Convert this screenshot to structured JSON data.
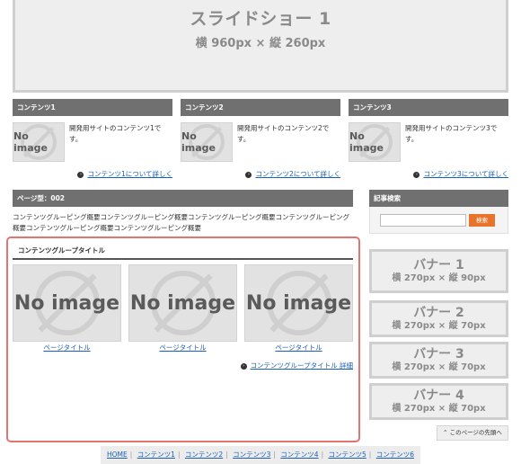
{
  "slideshow": {
    "title": "スライドショー 1",
    "size": "横 960px × 縦 260px"
  },
  "columns": [
    {
      "title": "コンテンツ1",
      "image_text": "No image",
      "text": "開発用サイトのコンテンツ1です。",
      "link": "コンテンツ1について詳しく"
    },
    {
      "title": "コンテンツ2",
      "image_text": "No image",
      "text": "開発用サイトのコンテンツ2です。",
      "link": "コンテンツ2について詳しく"
    },
    {
      "title": "コンテンツ3",
      "image_text": "No image",
      "text": "開発用サイトのコンテンツ3です。",
      "link": "コンテンツ3について詳しく"
    }
  ],
  "page": {
    "heading": "ページ型：002",
    "description": "コンテンツグルーピング概要コンテンツグルーピング概要コンテンツグルーピング概要コンテンツグルーピング概要コンテンツグルーピング概要コンテンツグルーピング概要"
  },
  "group": {
    "title": "コンテンツグループタイトル",
    "items": [
      {
        "image_text": "No image",
        "caption": "ページタイトル"
      },
      {
        "image_text": "No image",
        "caption": "ページタイトル"
      },
      {
        "image_text": "No image",
        "caption": "ページタイトル"
      }
    ],
    "more_link": "コンテンツグループタイトル 詳細"
  },
  "search": {
    "heading": "記事検索",
    "button": "検索",
    "placeholder": ""
  },
  "banners": [
    {
      "title": "バナー 1",
      "size": "横 270px × 縦 90px"
    },
    {
      "title": "バナー 2",
      "size": "横 270px × 縦 70px"
    },
    {
      "title": "バナー 3",
      "size": "横 270px × 縦 70px"
    },
    {
      "title": "バナー 4",
      "size": "横 270px × 縦 70px"
    }
  ],
  "back_to_top": "このページの先頭へ",
  "footer": {
    "links": [
      "HOME",
      "コンテンツ1",
      "コンテンツ2",
      "コンテンツ3",
      "コンテンツ4",
      "コンテンツ5",
      "コンテンツ6"
    ]
  },
  "colors": {
    "header_bar": "#707070",
    "search_button": "#e8732a",
    "link": "#1a5fb4",
    "highlight_border": "#e57373"
  }
}
